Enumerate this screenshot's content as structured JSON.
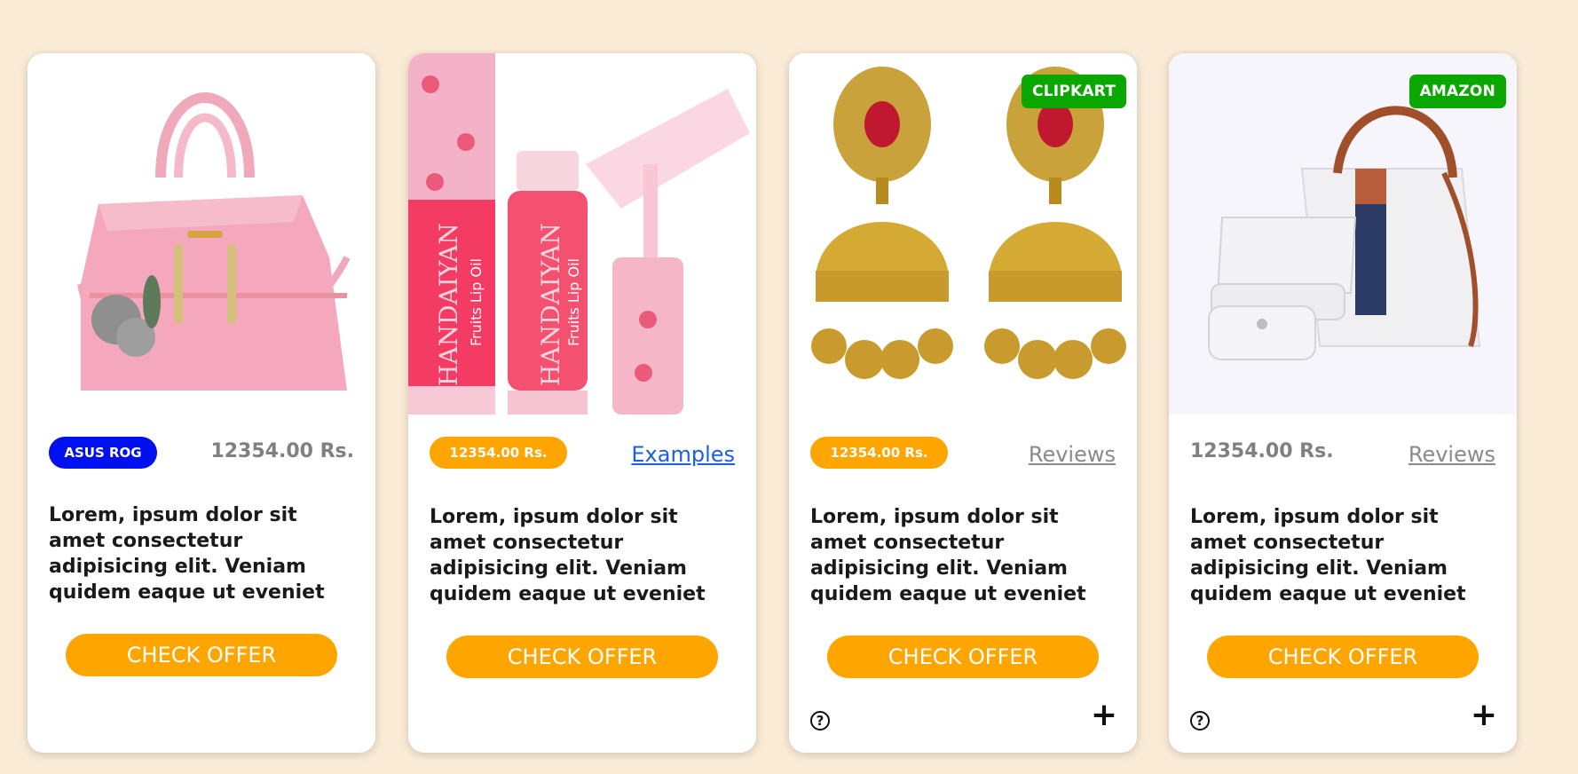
{
  "cards": [
    {
      "tag": "ASUS ROG",
      "price": "12354.00 Rs.",
      "description": "Lorem, ipsum dolor sit amet consectetur adipisicing elit. Veniam quidem eaque ut eveniet",
      "cta": "CHECK OFFER",
      "image": "pink-handbag"
    },
    {
      "price": "12354.00 Rs.",
      "link": "Examples",
      "description": "Lorem, ipsum dolor sit amet consectetur adipisicing elit. Veniam quidem eaque ut eveniet",
      "cta": "CHECK OFFER",
      "image": "lip-oil-bottles",
      "product_text": "HANDAIYAN",
      "product_subtext": "Fruits Lip Oil"
    },
    {
      "badge": "CLIPKART",
      "price": "12354.00 Rs.",
      "link": "Reviews",
      "description": "Lorem, ipsum dolor sit amet consectetur adipisicing elit. Veniam quidem eaque ut eveniet",
      "cta": "CHECK OFFER",
      "image": "gold-earrings",
      "help_icon": "question-circle-icon",
      "add_icon": "plus-icon"
    },
    {
      "badge": "AMAZON",
      "price": "12354.00 Rs.",
      "link": "Reviews",
      "description": "Lorem, ipsum dolor sit amet consectetur adipisicing elit. Veniam quidem eaque ut eveniet",
      "cta": "CHECK OFFER",
      "image": "white-handbag-set",
      "help_icon": "question-circle-icon",
      "add_icon": "plus-icon"
    }
  ],
  "colors": {
    "page_bg": "#faebd7",
    "orange": "#ffa500",
    "blue_pill": "#0010ee",
    "green_badge": "#0aa700",
    "link_blue": "#1a5fe6",
    "price_gray": "#808080"
  }
}
